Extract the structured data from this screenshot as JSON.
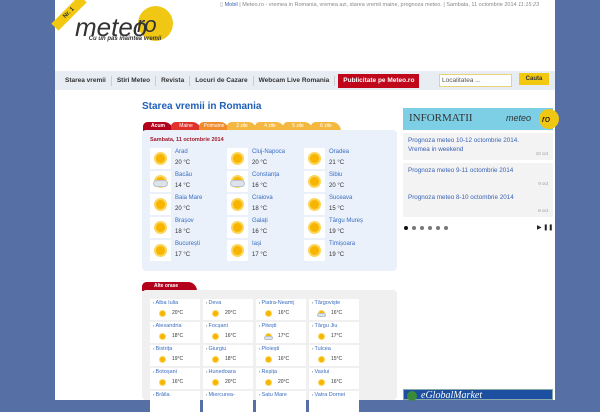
{
  "header": {
    "ribbon": "Nr. 1",
    "logo_meteo": "meteo",
    "logo_ro": "ro",
    "slogan": "Cu un pas inaintea vremii",
    "mobile": "Mobil",
    "tagline": "Meteo.ro - vremea in Romania, vremea azi, starea vremii maine, prognoza meteo.",
    "date": "Sambata, 11 octombrie 2014",
    "time": "11:15:23"
  },
  "nav": [
    "Starea vremii",
    "Stiri Meteo",
    "Revista",
    "Locuri de Cazare",
    "Webcam Live Romania"
  ],
  "nav_highlight": "Publicitate pe Meteo.ro",
  "search": {
    "placeholder": "Localitatea ...",
    "button": "Cauta"
  },
  "main": {
    "title": "Starea vremii in Romania",
    "tabs": [
      "Acum",
      "Maine",
      "Poimaine",
      "3 zile",
      "4 zile",
      "5 zile",
      "6 zile"
    ],
    "date": "Sambata, 11 octombrie 2014",
    "cities": [
      {
        "name": "Arad",
        "temp": "20 °C",
        "icon": "sun"
      },
      {
        "name": "Cluj-Napoca",
        "temp": "20 °C",
        "icon": "sun"
      },
      {
        "name": "Oradea",
        "temp": "21 °C",
        "icon": "sun"
      },
      {
        "name": "Bacău",
        "temp": "14 °C",
        "icon": "cloud-sun"
      },
      {
        "name": "Constanța",
        "temp": "16 °C",
        "icon": "cloud-sun"
      },
      {
        "name": "Sibiu",
        "temp": "20 °C",
        "icon": "sun"
      },
      {
        "name": "Baia Mare",
        "temp": "20 °C",
        "icon": "sun"
      },
      {
        "name": "Craiova",
        "temp": "18 °C",
        "icon": "sun"
      },
      {
        "name": "Suceava",
        "temp": "15 °C",
        "icon": "sun"
      },
      {
        "name": "Brașov",
        "temp": "18 °C",
        "icon": "sun"
      },
      {
        "name": "Galați",
        "temp": "16 °C",
        "icon": "sun"
      },
      {
        "name": "Târgu Mureș",
        "temp": "19 °C",
        "icon": "sun"
      },
      {
        "name": "București",
        "temp": "17 °C",
        "icon": "sun"
      },
      {
        "name": "Iași",
        "temp": "17 °C",
        "icon": "sun"
      },
      {
        "name": "Timișoara",
        "temp": "19 °C",
        "icon": "sun"
      }
    ]
  },
  "other": {
    "tab": "Alte orase",
    "cities": [
      {
        "name": "Alba Iulia",
        "temp": "20°C",
        "icon": "sun"
      },
      {
        "name": "Deva",
        "temp": "20°C",
        "icon": "sun"
      },
      {
        "name": "Piatra-Neamț",
        "temp": "16°C",
        "icon": "sun"
      },
      {
        "name": "Târgoviște",
        "temp": "16°C",
        "icon": "cloud-sun"
      },
      {
        "name": "Alexandria",
        "temp": "18°C",
        "icon": "sun"
      },
      {
        "name": "Focșani",
        "temp": "16°C",
        "icon": "sun"
      },
      {
        "name": "Pitești",
        "temp": "17°C",
        "icon": "cloud-sun"
      },
      {
        "name": "Târgu Jiu",
        "temp": "17°C",
        "icon": "sun"
      },
      {
        "name": "Bistrița",
        "temp": "19°C",
        "icon": "sun"
      },
      {
        "name": "Giurgiu",
        "temp": "18°C",
        "icon": "sun"
      },
      {
        "name": "Ploiești",
        "temp": "16°C",
        "icon": "sun"
      },
      {
        "name": "Tulcea",
        "temp": "15°C",
        "icon": "sun"
      },
      {
        "name": "Botoșani",
        "temp": "16°C",
        "icon": "sun"
      },
      {
        "name": "Hunedoara",
        "temp": "20°C",
        "icon": "sun"
      },
      {
        "name": "Reșița",
        "temp": "20°C",
        "icon": "sun"
      },
      {
        "name": "Vaslui",
        "temp": "16°C",
        "icon": "sun"
      },
      {
        "name": "Brăila",
        "temp": "",
        "icon": ""
      },
      {
        "name": "Miercurea-",
        "temp": "",
        "icon": ""
      },
      {
        "name": "Satu Mare",
        "temp": "",
        "icon": ""
      },
      {
        "name": "Vatra Dornei",
        "temp": "",
        "icon": ""
      }
    ]
  },
  "info": {
    "title": "INFORMATII",
    "logo_meteo": "meteo",
    "logo_ro": "ro",
    "news": [
      {
        "title": "Prognoza meteo 10-12 octombrie 2014. Vremea in weekend",
        "date": "10 oct"
      },
      {
        "title": "Prognoza meteo 9-11 octombrie 2014",
        "date": "9 oct"
      },
      {
        "title": "Prognoza meteo 8-10 octombrie 2014",
        "date": "8 oct"
      }
    ],
    "controls": "▶ ❚❚"
  },
  "ad": {
    "text": "eGlobalMarket"
  }
}
